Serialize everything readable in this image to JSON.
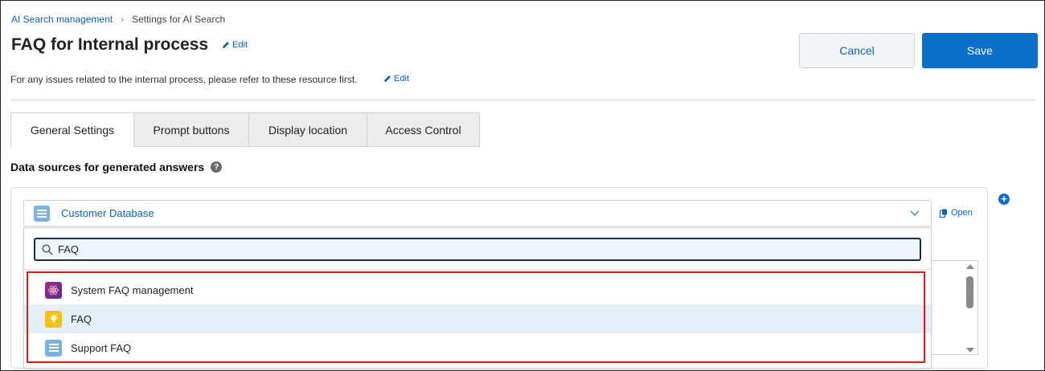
{
  "breadcrumb": {
    "parent": "AI Search management",
    "current": "Settings for AI Search"
  },
  "header": {
    "title": "FAQ for Internal process",
    "edit_label": "Edit",
    "description": "For any issues related to the internal process, please refer to these resource first.",
    "description_edit_label": "Edit"
  },
  "actions": {
    "cancel_label": "Cancel",
    "save_label": "Save"
  },
  "tabs": [
    {
      "label": "General Settings",
      "active": true
    },
    {
      "label": "Prompt buttons",
      "active": false
    },
    {
      "label": "Display location",
      "active": false
    },
    {
      "label": "Access Control",
      "active": false
    }
  ],
  "data_sources": {
    "section_title": "Data sources for generated answers",
    "selected": "Customer Database",
    "open_label": "Open",
    "search_value": "FAQ",
    "options": [
      {
        "label": "System FAQ management",
        "icon": "atom-app-icon",
        "highlighted": false
      },
      {
        "label": "FAQ",
        "icon": "lightbulb-app-icon",
        "highlighted": true
      },
      {
        "label": "Support FAQ",
        "icon": "database-list-icon",
        "highlighted": false
      }
    ]
  },
  "colors": {
    "accent": "#0b6ec8",
    "link": "#0b63b6",
    "highlight": "#e4effa",
    "annotation": "#e01b1b"
  }
}
